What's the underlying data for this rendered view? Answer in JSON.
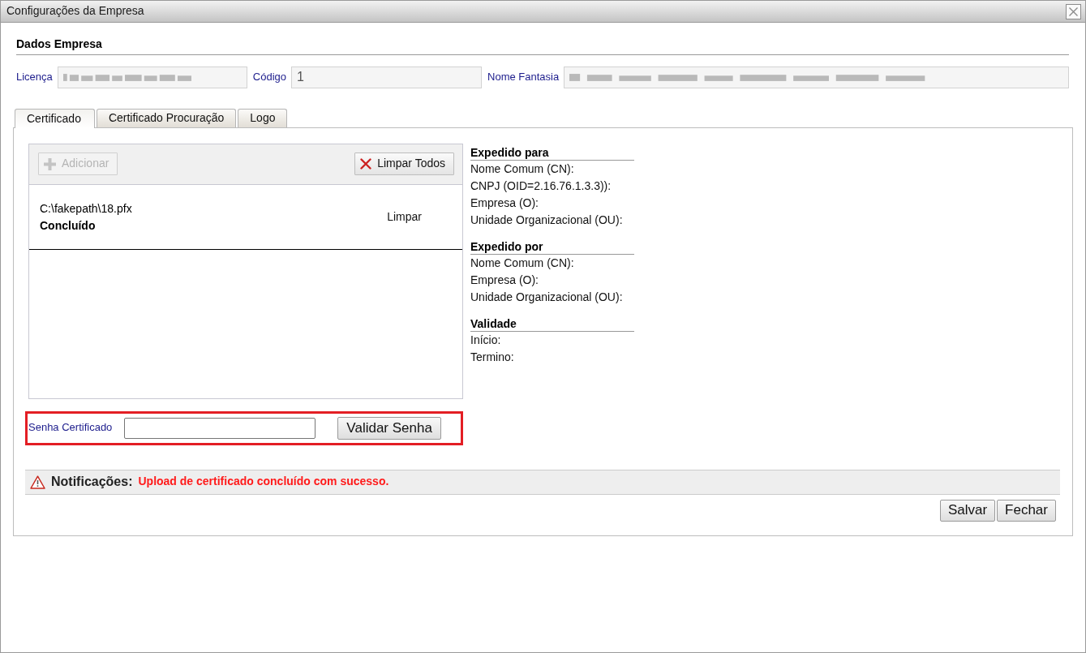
{
  "window": {
    "title": "Configurações da Empresa"
  },
  "company": {
    "title": "Dados Empresa",
    "fields": [
      {
        "label": "Licença",
        "obscured": true
      },
      {
        "label": "Código",
        "value": "1",
        "obscured": false
      },
      {
        "label": "Nome Fantasia",
        "obscured": true
      }
    ]
  },
  "tabs": [
    {
      "label": "Certificado",
      "selected": true
    },
    {
      "label": "Certificado Procuração",
      "selected": false
    },
    {
      "label": "Logo",
      "selected": false
    }
  ],
  "upload": {
    "buttons": [
      {
        "kind": "add",
        "label": "Adicionar",
        "disabled": true
      },
      {
        "kind": "clear",
        "label": "Limpar Todos",
        "disabled": false
      }
    ],
    "files": [
      {
        "name": "C:\\fakepath\\18.pfx",
        "status": "Concluído",
        "action": "Limpar"
      }
    ]
  },
  "password": {
    "label": "Senha Certificado",
    "button": "Validar Senha",
    "highlighted": true
  },
  "details": [
    {
      "title": "Expedido para",
      "items": [
        "Nome Comum (CN):",
        "CNPJ (OID=2.16.76.1.3.3)):",
        "Empresa (O):",
        "Unidade Organizacional (OU):"
      ]
    },
    {
      "title": "Expedido por",
      "items": [
        "Nome Comum (CN):",
        "Empresa (O):",
        "Unidade Organizacional (OU):"
      ]
    },
    {
      "title": "Validade",
      "items": [
        "Início:",
        "Termino:"
      ]
    }
  ],
  "notification": {
    "label": "Notificações:",
    "message": "Upload de certificado concluído com sucesso."
  },
  "buttons": [
    "Salvar",
    "Fechar"
  ]
}
